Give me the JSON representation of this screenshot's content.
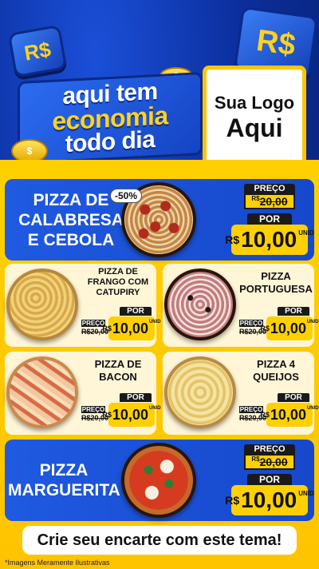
{
  "header": {
    "headline_line1": "aqui tem",
    "headline_line2": "economia",
    "headline_line3": "todo dia",
    "currency_badge": "R$",
    "coin_symbol": "$",
    "logo_line1": "Sua Logo",
    "logo_line2": "Aqui"
  },
  "featured": [
    {
      "name_lines": [
        "PIZZA DE",
        "CALABRESA",
        "E CEBOLA"
      ],
      "discount_badge": "-50%",
      "price_label": "PREÇO",
      "old_currency": "R$",
      "old_price": "20,00",
      "por_label": "POR",
      "currency": "R$",
      "new_price": "10,00",
      "unit": "UNID"
    },
    {
      "name_lines": [
        "PIZZA",
        "MARGUERITA"
      ],
      "price_label": "PREÇO",
      "old_currency": "R$",
      "old_price": "20,00",
      "por_label": "POR",
      "currency": "R$",
      "new_price": "10,00",
      "unit": "UNID"
    }
  ],
  "grid": [
    {
      "name_lines": [
        "PIZZA DE",
        "FRANGO COM",
        "CATUPIRY"
      ],
      "price_label": "PREÇO",
      "old_price": "R$20,00",
      "por_label": "POR",
      "currency": "R$",
      "new_price": "10,00",
      "unit": "UNID"
    },
    {
      "name_lines": [
        "PIZZA",
        "PORTUGUESA"
      ],
      "price_label": "PREÇO",
      "old_price": "R$20,00",
      "por_label": "POR",
      "currency": "R$",
      "new_price": "10,00",
      "unit": "UNID"
    },
    {
      "name_lines": [
        "PIZZA DE",
        "BACON"
      ],
      "price_label": "PREÇO",
      "old_price": "R$20,00",
      "por_label": "POR",
      "currency": "R$",
      "new_price": "10,00",
      "unit": "UNID"
    },
    {
      "name_lines": [
        "PIZZA 4",
        "QUEIJOS"
      ],
      "price_label": "PREÇO",
      "old_price": "R$20,00",
      "por_label": "POR",
      "currency": "R$",
      "new_price": "10,00",
      "unit": "UNID"
    }
  ],
  "footer": {
    "cta": "Crie seu encarte com este tema!",
    "disclaimer": "*Imagens Meramente Ilustrativas"
  },
  "colors": {
    "brand_blue": "#1648cc",
    "brand_yellow": "#ffd000",
    "cream": "#fff6d8",
    "dark": "#1a1a1a"
  }
}
